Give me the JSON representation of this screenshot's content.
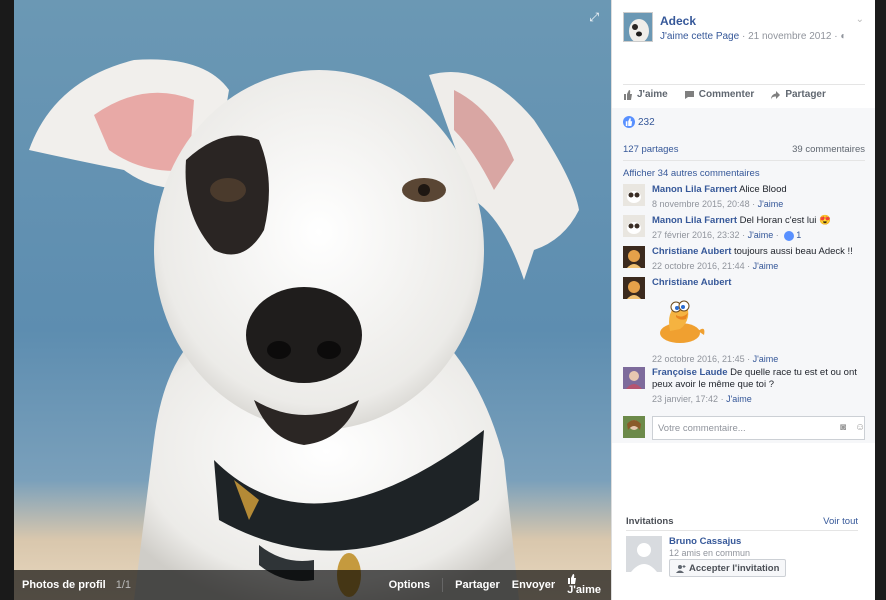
{
  "photo": {
    "album_label": "Photos de profil",
    "count": "1/1",
    "actions": [
      "Options",
      "Partager",
      "Envoyer",
      "J'aime"
    ]
  },
  "post": {
    "page_name": "Adeck",
    "like_page": "J'aime cette Page",
    "date": "21 novembre 2012",
    "actions": [
      "J'aime",
      "Commenter",
      "Partager"
    ],
    "reaction_count": "232",
    "shares": "127 partages",
    "comments_count": "39 commentaires",
    "more_comments": "Afficher 34 autres commentaires",
    "like_label": "J'aime"
  },
  "comments": [
    {
      "author": "Manon Lila Farnert",
      "text": "Alice Blood",
      "time": "8 novembre 2015, 20:48"
    },
    {
      "author": "Manon Lila Farnert",
      "text": "Del Horan c'est lui",
      "emoji": "😍",
      "time": "27 février 2016, 23:32",
      "likes": "1"
    },
    {
      "author": "Christiane Aubert",
      "text": "toujours aussi beau Adeck !!",
      "time": "22 octobre 2016, 21:44"
    },
    {
      "author": "Christiane Aubert",
      "text": "",
      "time": "22 octobre 2016, 21:45"
    },
    {
      "author": "Françoise Laude",
      "text": "De quelle race tu est et ou ont peux avoir le même que toi ?",
      "time": "23 janvier, 17:42"
    }
  ],
  "composer": {
    "placeholder": "Votre commentaire..."
  },
  "invitations": {
    "title": "Invitations",
    "see_all": "Voir tout",
    "name": "Bruno Cassajus",
    "mutual": "12 amis en commun",
    "accept": "Accepter l'invitation"
  },
  "colors": {
    "link": "#365899",
    "accent": "#5890ff",
    "panel_bg": "#ffffff"
  }
}
